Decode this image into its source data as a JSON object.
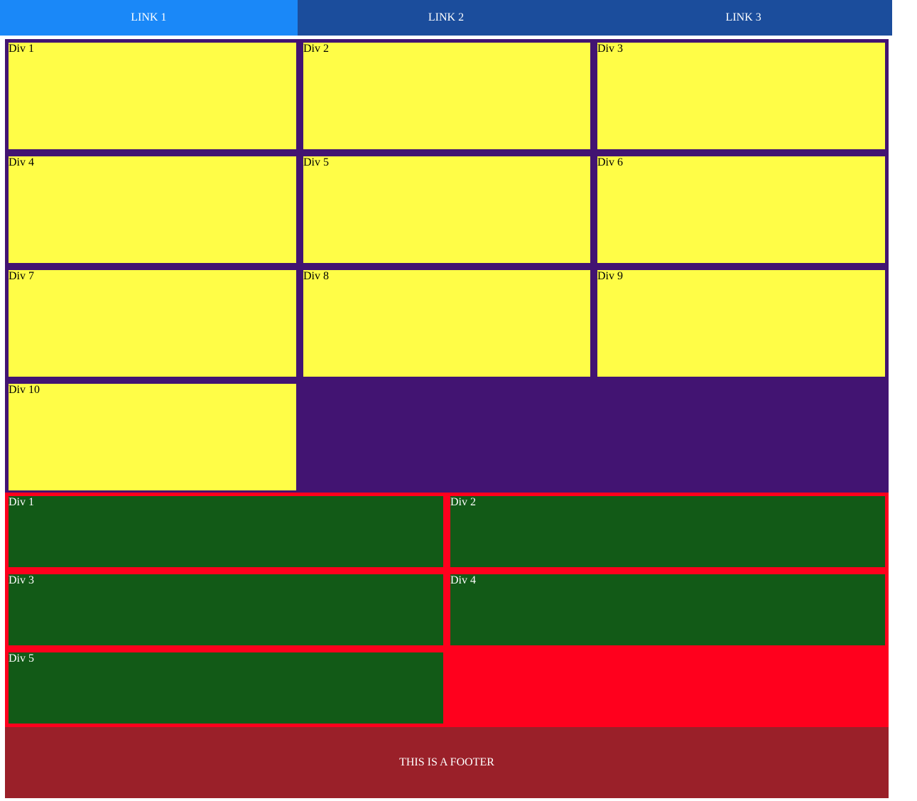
{
  "nav": {
    "links": [
      "LINK 1",
      "LINK 2",
      "LINK 3"
    ],
    "active": 0
  },
  "grid1": {
    "items": [
      "Div 1",
      "Div 2",
      "Div 3",
      "Div 4",
      "Div 5",
      "Div 6",
      "Div 7",
      "Div 8",
      "Div 9",
      "Div 10"
    ]
  },
  "grid2": {
    "items": [
      "Div 1",
      "Div 2",
      "Div 3",
      "Div 4",
      "Div 5"
    ]
  },
  "footer": {
    "text": "THIS IS A FOOTER"
  },
  "colors": {
    "nav_active": "#1a88f8",
    "nav": "#1b4d9c",
    "grid1_bg": "#421472",
    "grid1_item": "#fffd47",
    "grid2_bg": "#ff001d",
    "grid2_item": "#125a17",
    "footer": "#9a2029"
  }
}
